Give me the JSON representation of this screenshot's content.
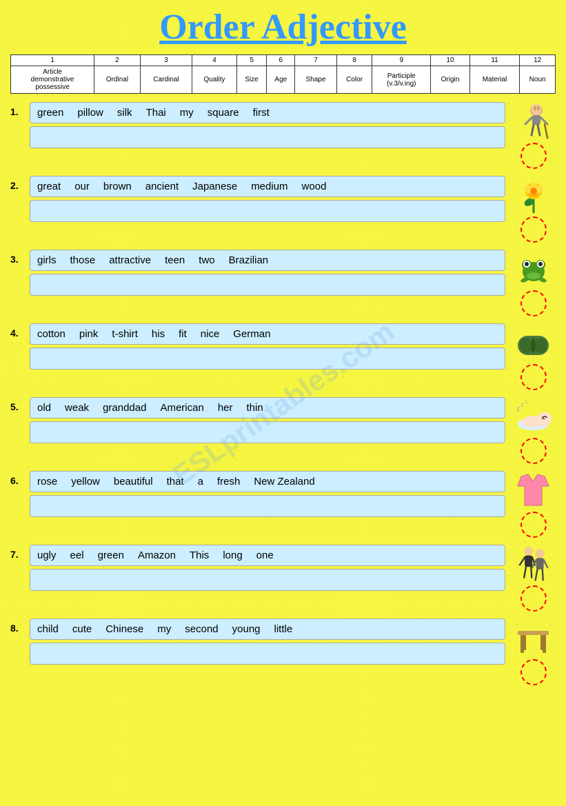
{
  "title": "Order Adjective",
  "watermark": "ESLprintables.com",
  "header": {
    "numbers": [
      "1",
      "2",
      "3",
      "4",
      "5",
      "6",
      "7",
      "8",
      "9",
      "10",
      "11",
      "12"
    ],
    "labels": [
      "Article demonstrative possessive",
      "Ordinal",
      "Cardinal",
      "Quality",
      "Size",
      "Age",
      "Shape",
      "Color",
      "Participle (v.3/v.ing)",
      "Origin",
      "Material",
      "Noun"
    ]
  },
  "exercises": [
    {
      "num": "1.",
      "words": [
        "green",
        "pillow",
        "silk",
        "Thai",
        "my",
        "square",
        "first"
      ],
      "answer": ""
    },
    {
      "num": "2.",
      "words": [
        "great",
        "our",
        "brown",
        "ancient",
        "Japanese",
        "medium",
        "wood"
      ],
      "answer": ""
    },
    {
      "num": "3.",
      "words": [
        "girls",
        "those",
        "attractive",
        "teen",
        "two",
        "Brazilian"
      ],
      "answer": ""
    },
    {
      "num": "4.",
      "words": [
        "cotton",
        "pink",
        "t-shirt",
        "his",
        "fit",
        "nice",
        "German"
      ],
      "answer": ""
    },
    {
      "num": "5.",
      "words": [
        "old",
        "weak",
        "granddad",
        "American",
        "her",
        "thin"
      ],
      "answer": ""
    },
    {
      "num": "6.",
      "words": [
        "rose",
        "yellow",
        "beautiful",
        "that",
        "a",
        "fresh",
        "New Zealand"
      ],
      "answer": ""
    },
    {
      "num": "7.",
      "words": [
        "ugly",
        "eel",
        "green",
        "Amazon",
        "This",
        "long",
        "one"
      ],
      "answer": ""
    },
    {
      "num": "8.",
      "words": [
        "child",
        "cute",
        "Chinese",
        "my",
        "second",
        "young",
        "little"
      ],
      "answer": ""
    }
  ],
  "images": [
    "old-man",
    "rose",
    "frog",
    "pillow",
    "sleeping-baby",
    "t-shirt",
    "girls",
    "table"
  ]
}
